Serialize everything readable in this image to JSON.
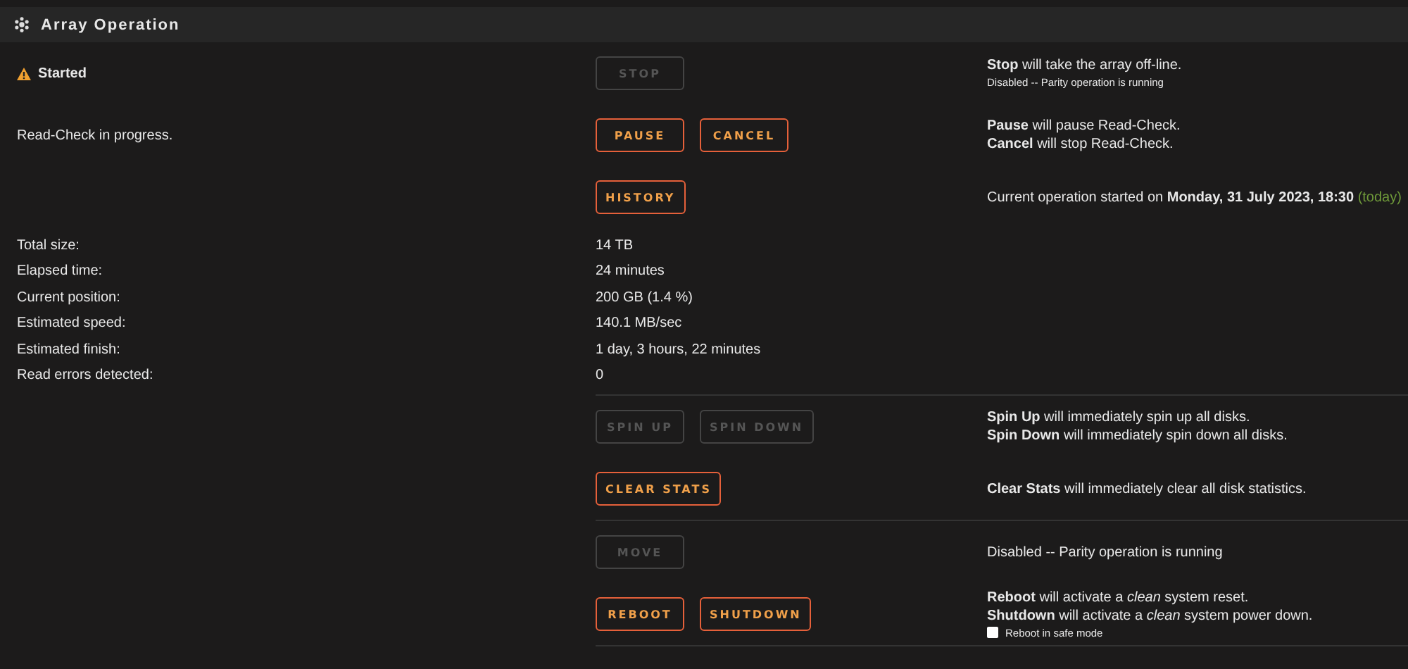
{
  "header": {
    "title": "Array Operation"
  },
  "sections": [
    {
      "rows": [
        {
          "status": {
            "text": "Started",
            "warning": true
          },
          "buttons": [
            {
              "label": "STOP",
              "disabled": true
            }
          ],
          "notes": [
            {
              "kind": "line",
              "text": "**Stop** will take the array off-line."
            },
            {
              "kind": "small",
              "text": "Disabled -- Parity operation is running"
            }
          ]
        },
        {
          "status": {
            "text": "Read-Check in progress.",
            "warning": false
          },
          "buttons": [
            {
              "label": "PAUSE",
              "disabled": false
            },
            {
              "label": "CANCEL",
              "disabled": false
            }
          ],
          "notes": [
            {
              "kind": "line",
              "text": "**Pause** will pause Read-Check."
            },
            {
              "kind": "line",
              "text": "**Cancel** will stop Read-Check."
            }
          ]
        },
        {
          "buttons": [
            {
              "label": "HISTORY",
              "disabled": false
            }
          ],
          "notes": [
            {
              "kind": "line",
              "text": "Current operation started on **Monday, 31 July 2023, 18:30**",
              "suffix": "(today)"
            }
          ]
        }
      ],
      "stats": [
        {
          "label": "Total size:",
          "value": "14 TB"
        },
        {
          "label": "Elapsed time:",
          "value": "24 minutes"
        },
        {
          "label": "Current position:",
          "value": "200 GB (1.4 %)"
        },
        {
          "label": "Estimated speed:",
          "value": "140.1 MB/sec"
        },
        {
          "label": "Estimated finish:",
          "value": "1 day, 3 hours, 22 minutes"
        },
        {
          "label": "Read errors detected:",
          "value": "0"
        }
      ]
    },
    {
      "rows": [
        {
          "buttons": [
            {
              "label": "SPIN UP",
              "disabled": true
            },
            {
              "label": "SPIN DOWN",
              "disabled": true
            }
          ],
          "notes": [
            {
              "kind": "line",
              "text": "**Spin Up** will immediately spin up all disks."
            },
            {
              "kind": "line",
              "text": "**Spin Down** will immediately spin down all disks."
            }
          ]
        },
        {
          "buttons": [
            {
              "label": "CLEAR STATS",
              "disabled": false
            }
          ],
          "notes": [
            {
              "kind": "line",
              "text": "**Clear Stats** will immediately clear all disk statistics."
            }
          ]
        }
      ]
    },
    {
      "rows": [
        {
          "buttons": [
            {
              "label": "MOVE",
              "disabled": true
            }
          ],
          "notes": [
            {
              "kind": "line",
              "text": "Disabled -- Parity operation is running"
            }
          ]
        },
        {
          "buttons": [
            {
              "label": "REBOOT",
              "disabled": false
            },
            {
              "label": "SHUTDOWN",
              "disabled": false
            }
          ],
          "notes": [
            {
              "kind": "line",
              "text": "**Reboot** will activate a *clean* system reset."
            },
            {
              "kind": "line",
              "text": "**Shutdown** will activate a *clean* system power down."
            },
            {
              "kind": "checkbox",
              "text": "Reboot in safe mode",
              "checked": false
            }
          ]
        }
      ]
    }
  ]
}
